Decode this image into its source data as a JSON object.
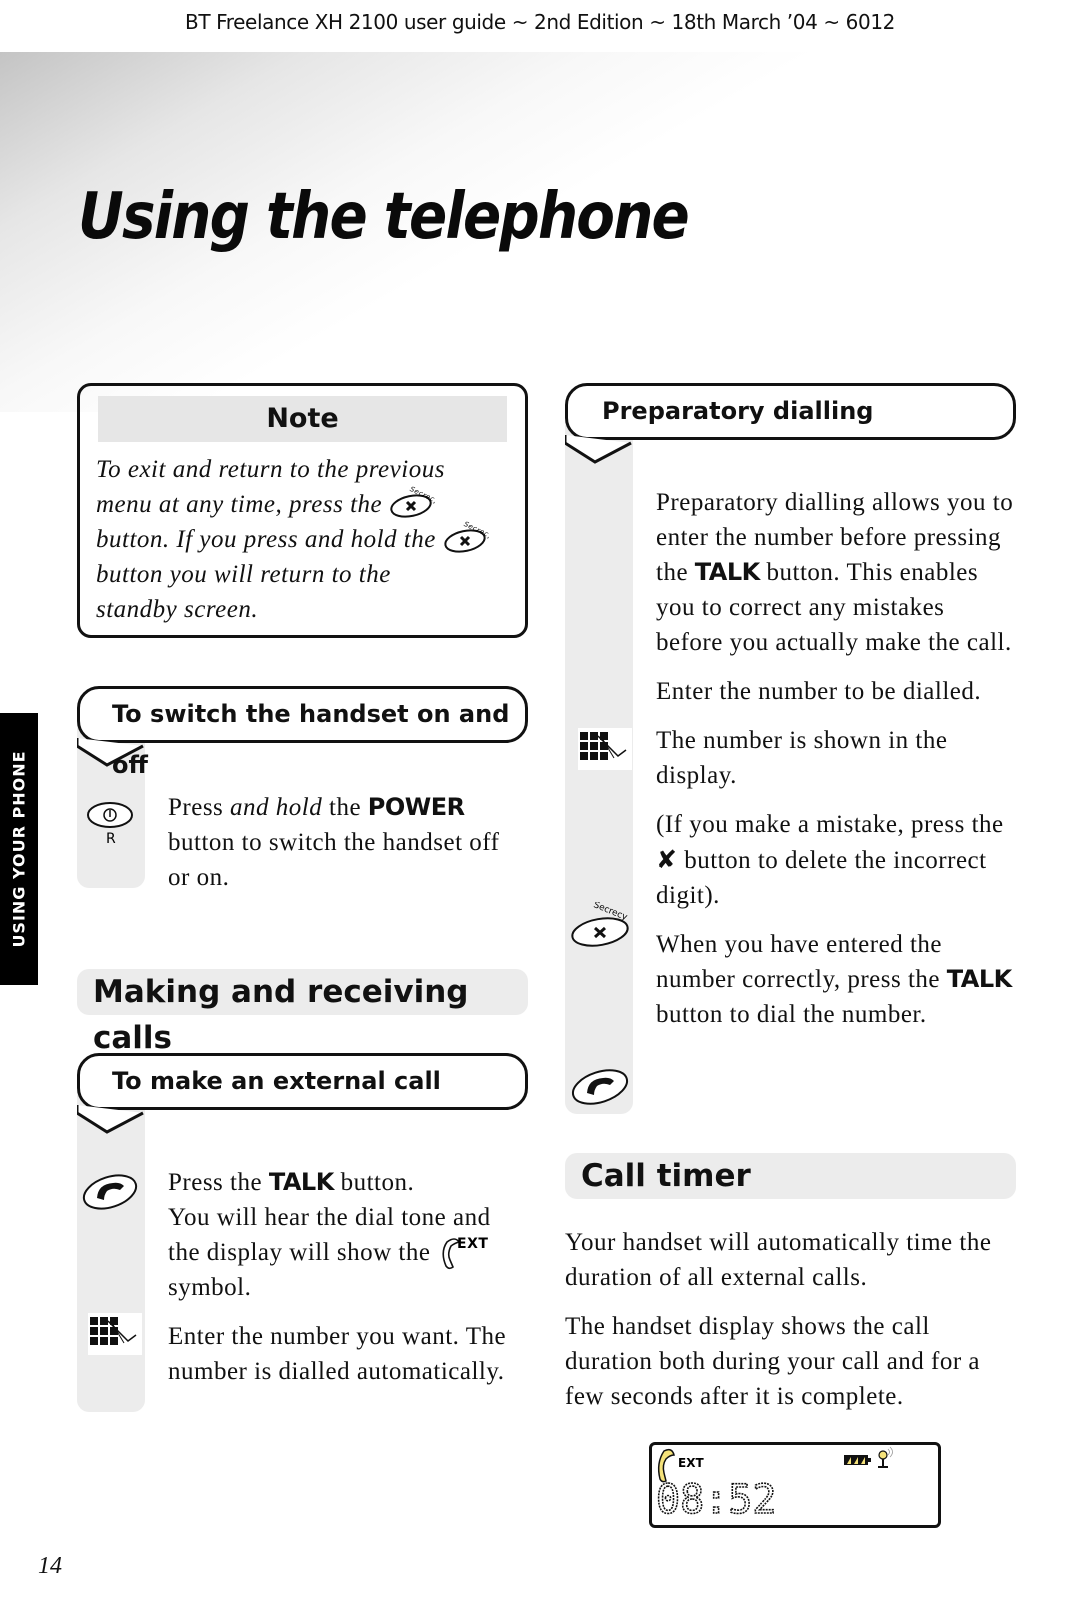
{
  "header": {
    "running_title": "BT Freelance XH 2100 user guide ~ 2nd Edition ~ 18th March ’04 ~ 6012"
  },
  "page": {
    "title": "Using the telephone",
    "number": "14",
    "side_tab": "USING YOUR PHONE"
  },
  "note": {
    "heading": "Note",
    "line1": "To exit and return to the previous",
    "line2": "menu at any time, press the",
    "line3": "button. If you press and hold the",
    "line4": "button you will return to the",
    "line5": "standby screen.",
    "icon_label": "Secrecy"
  },
  "switch_section": {
    "heading": "To switch the handset on and off",
    "text_pre": "Press ",
    "text_em": "and hold",
    "text_mid": " the ",
    "keyword": "POWER",
    "text_post": " button to switch the handset off or on.",
    "icon_sublabel": "R"
  },
  "making_calls": {
    "heading": "Making and receiving calls"
  },
  "external_call": {
    "heading": "To make an external call",
    "p1_pre": "Press the ",
    "p1_kw": "TALK",
    "p1_post": " button.",
    "p1_line2": "You will hear the dial tone and the display will show the",
    "p1_symbol": "EXT",
    "p1_end": "symbol.",
    "p2": "Enter the number you want. The number is dialled automatically."
  },
  "preparatory": {
    "heading": "Preparatory dialling",
    "intro_pre": "Preparatory dialling allows you to enter the number before pressing the ",
    "intro_kw": "TALK",
    "intro_post": " button. This enables you to correct any mistakes before you actually make the call.",
    "step1": "Enter the number to be dialled.",
    "step2": "The number is shown in the display.",
    "step3_pre": "(If you make a mistake, press the ",
    "step3_symbol": "✘",
    "step3_post": " button to delete the incorrect digit).",
    "step4_pre": "When you have entered the number correctly, press the ",
    "step4_kw": "TALK",
    "step4_post": " button to dial the number.",
    "icon_label": "Secrecy"
  },
  "call_timer": {
    "heading": "Call timer",
    "p1": "Your handset will automatically time the duration of all external calls.",
    "p2": "The handset display shows the call duration both during your call and for a few seconds after it is complete.",
    "display": {
      "line_label": "EXT",
      "time": "08:52"
    }
  },
  "colors": {
    "accent_yellow": "#f5e27a",
    "panel_grey": "#ececec",
    "side_tab": "#000000"
  }
}
